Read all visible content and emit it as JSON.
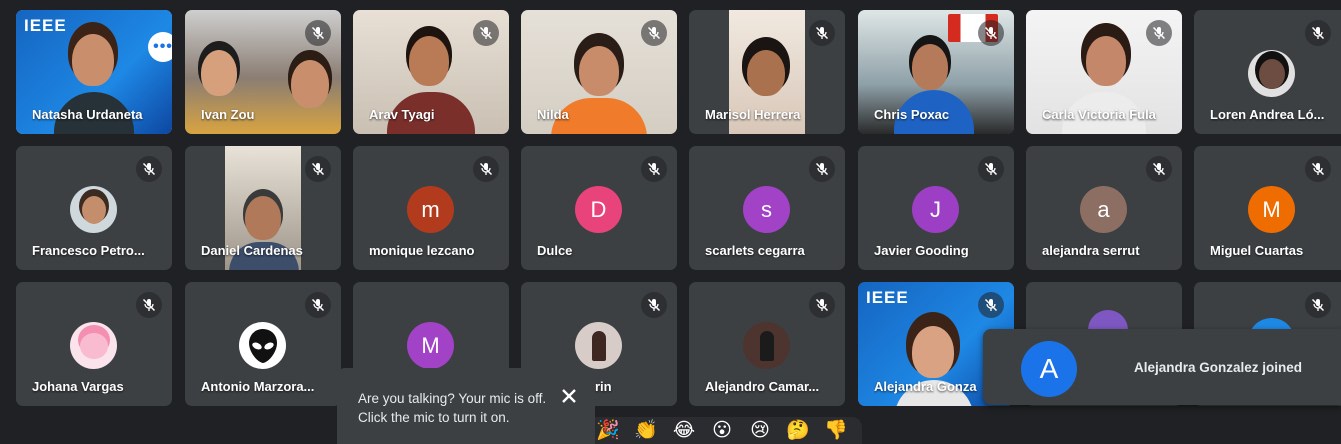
{
  "colors": {
    "background": "#202124",
    "tile": "#3c4043",
    "active_border": "#8ab4f8",
    "ieee_blue": "#1565c0"
  },
  "tiles": [
    {
      "name": "Natasha Urdaneta",
      "kind": "video",
      "active": true,
      "muted": false
    },
    {
      "name": "Ivan Zou",
      "kind": "video",
      "muted": true
    },
    {
      "name": "Arav Tyagi",
      "kind": "video",
      "muted": true
    },
    {
      "name": "Nilda",
      "kind": "video",
      "muted": true
    },
    {
      "name": "Marisol Herrera",
      "kind": "video",
      "muted": true
    },
    {
      "name": "Chris Poxac",
      "kind": "video",
      "muted": true
    },
    {
      "name": "Carla Victoria Fula",
      "kind": "video",
      "muted": true
    },
    {
      "name": "Loren Andrea Ló...",
      "kind": "photo",
      "muted": true
    },
    {
      "name": "Francesco Petro...",
      "kind": "photo",
      "muted": true
    },
    {
      "name": "Daniel Cardenas",
      "kind": "video",
      "muted": true
    },
    {
      "name": "monique lezcano",
      "kind": "letter",
      "letter": "m",
      "color": "#b23b1e",
      "muted": true
    },
    {
      "name": "Dulce",
      "kind": "letter",
      "letter": "D",
      "color": "#e8437a",
      "muted": true
    },
    {
      "name": "scarlets cegarra",
      "kind": "letter",
      "letter": "s",
      "color": "#a142c7",
      "muted": true
    },
    {
      "name": "Javier Gooding",
      "kind": "letter",
      "letter": "J",
      "color": "#9c3fc4",
      "muted": true
    },
    {
      "name": "alejandra serrut",
      "kind": "letter",
      "letter": "a",
      "color": "#8d6e63",
      "muted": true
    },
    {
      "name": "Miguel Cuartas",
      "kind": "letter",
      "letter": "M",
      "color": "#ef6c00",
      "muted": true
    },
    {
      "name": "Johana Vargas",
      "kind": "photo",
      "muted": true
    },
    {
      "name": "Antonio Marzora...",
      "kind": "photo",
      "muted": true
    },
    {
      "name": "",
      "kind": "letter",
      "letter": "M",
      "color": "#a142c7",
      "muted": true
    },
    {
      "name": "rin",
      "kind": "photo",
      "muted": true
    },
    {
      "name": "Alejandro Camar...",
      "kind": "photo",
      "muted": true
    },
    {
      "name": "Alejandra Gonza",
      "kind": "video",
      "muted": true
    },
    {
      "name": "",
      "kind": "photo",
      "muted": false
    },
    {
      "name": "",
      "kind": "photo",
      "muted": true
    }
  ],
  "ieee_logo": "IEEE",
  "more_options_label": "•••",
  "mic_toast": {
    "text": "Are you talking? Your mic is off. Click the mic to turn it on.",
    "close_icon": "close-icon"
  },
  "reactions": [
    "🎉",
    "👏",
    "😂",
    "😮",
    "😢",
    "🤔",
    "👎"
  ],
  "join_toast": {
    "avatar_letter": "A",
    "text": "Alejandra Gonzalez joined"
  }
}
